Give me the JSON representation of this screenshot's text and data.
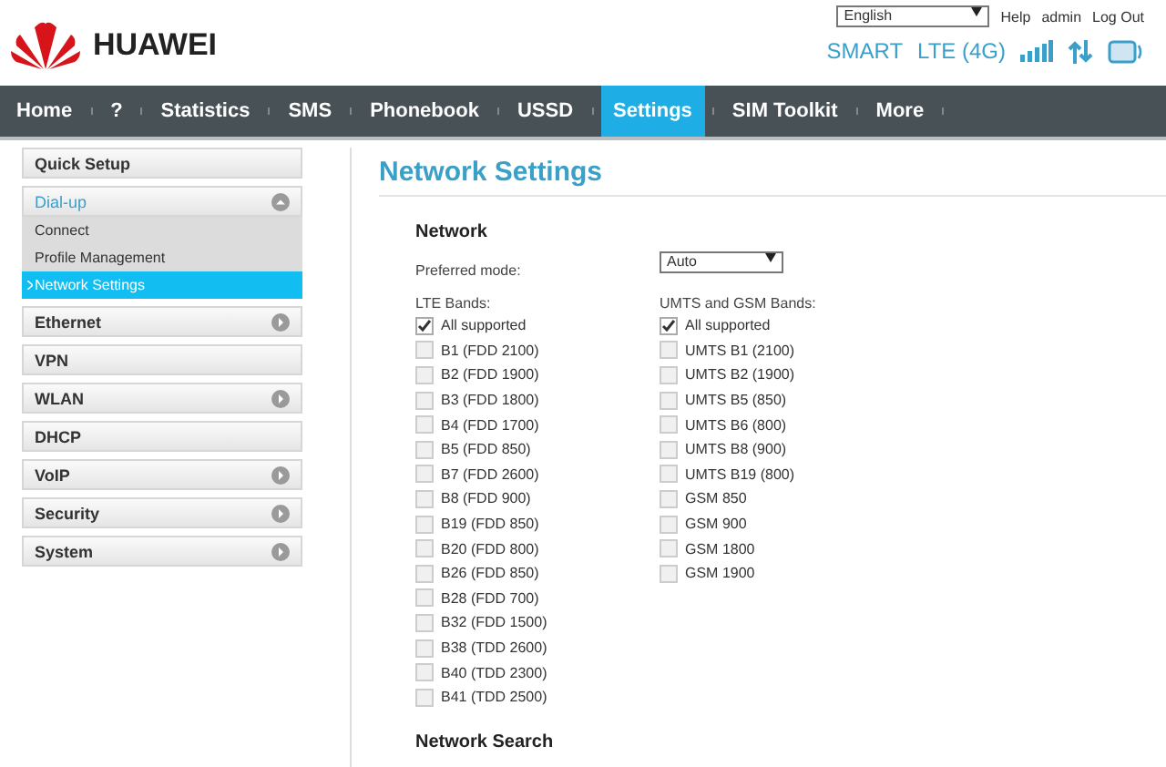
{
  "header": {
    "brand": "HUAWEI",
    "language": "English",
    "links": [
      "Help",
      "admin",
      "Log Out"
    ],
    "status": [
      "SMART",
      "LTE (4G)"
    ]
  },
  "nav": [
    {
      "label": "Home",
      "selected": false
    },
    {
      "label": "?",
      "selected": false
    },
    {
      "label": "Statistics",
      "selected": false
    },
    {
      "label": "SMS",
      "selected": false
    },
    {
      "label": "Phonebook",
      "selected": false
    },
    {
      "label": "USSD",
      "selected": false
    },
    {
      "label": "Settings",
      "selected": true
    },
    {
      "label": "SIM Toolkit",
      "selected": false
    },
    {
      "label": "More",
      "selected": false
    }
  ],
  "sidebar": [
    {
      "label": "Quick Setup",
      "has_arrow": false,
      "expanded": false
    },
    {
      "label": "Dial-up",
      "has_arrow": true,
      "expanded": true,
      "children": [
        {
          "label": "Connect",
          "selected": false
        },
        {
          "label": "Profile Management",
          "selected": false
        },
        {
          "label": "Network Settings",
          "selected": true
        }
      ]
    },
    {
      "label": "Ethernet",
      "has_arrow": true,
      "expanded": false
    },
    {
      "label": "VPN",
      "has_arrow": false,
      "expanded": false
    },
    {
      "label": "WLAN",
      "has_arrow": true,
      "expanded": false
    },
    {
      "label": "DHCP",
      "has_arrow": false,
      "expanded": false
    },
    {
      "label": "VoIP",
      "has_arrow": true,
      "expanded": false
    },
    {
      "label": "Security",
      "has_arrow": true,
      "expanded": false
    },
    {
      "label": "System",
      "has_arrow": true,
      "expanded": false
    }
  ],
  "page_title": "Network Settings",
  "network": {
    "heading": "Network",
    "preferred_mode_label": "Preferred mode:",
    "preferred_mode": "Auto",
    "lte": {
      "label": "LTE Bands:",
      "bands": [
        {
          "label": "All supported",
          "checked": true
        },
        {
          "label": "B1 (FDD 2100)",
          "checked": false
        },
        {
          "label": "B2 (FDD 1900)",
          "checked": false
        },
        {
          "label": "B3 (FDD 1800)",
          "checked": false
        },
        {
          "label": "B4 (FDD 1700)",
          "checked": false
        },
        {
          "label": "B5 (FDD 850)",
          "checked": false
        },
        {
          "label": "B7 (FDD 2600)",
          "checked": false
        },
        {
          "label": "B8 (FDD 900)",
          "checked": false
        },
        {
          "label": "B19 (FDD 850)",
          "checked": false
        },
        {
          "label": "B20 (FDD 800)",
          "checked": false
        },
        {
          "label": "B26 (FDD 850)",
          "checked": false
        },
        {
          "label": "B28 (FDD 700)",
          "checked": false
        },
        {
          "label": "B32 (FDD 1500)",
          "checked": false
        },
        {
          "label": "B38 (TDD 2600)",
          "checked": false
        },
        {
          "label": "B40 (TDD 2300)",
          "checked": false
        },
        {
          "label": "B41 (TDD 2500)",
          "checked": false
        }
      ]
    },
    "umts": {
      "label": "UMTS and GSM Bands:",
      "bands": [
        {
          "label": "All supported",
          "checked": true
        },
        {
          "label": "UMTS B1 (2100)",
          "checked": false
        },
        {
          "label": "UMTS B2 (1900)",
          "checked": false
        },
        {
          "label": "UMTS B5 (850)",
          "checked": false
        },
        {
          "label": "UMTS B6 (800)",
          "checked": false
        },
        {
          "label": "UMTS B8 (900)",
          "checked": false
        },
        {
          "label": "UMTS B19 (800)",
          "checked": false
        },
        {
          "label": "GSM 850",
          "checked": false
        },
        {
          "label": "GSM 900",
          "checked": false
        },
        {
          "label": "GSM 1800",
          "checked": false
        },
        {
          "label": "GSM 1900",
          "checked": false
        }
      ]
    }
  },
  "network_search": {
    "heading": "Network Search"
  }
}
